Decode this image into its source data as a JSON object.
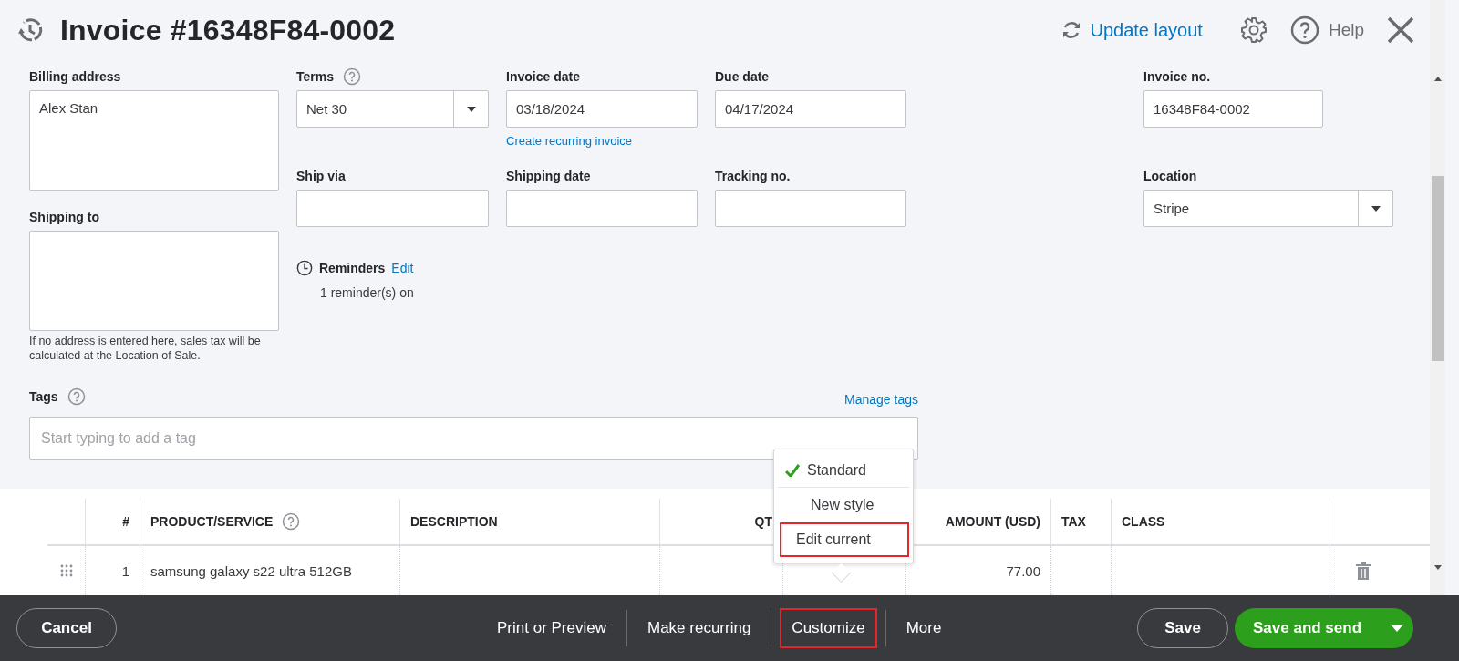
{
  "header": {
    "title": "Invoice #16348F84-0002",
    "update_layout": "Update layout",
    "help": "Help"
  },
  "form": {
    "billing_address": {
      "label": "Billing address",
      "value": "Alex Stan"
    },
    "shipping_to": {
      "label": "Shipping to",
      "note": "If no address is entered here, sales tax will be calculated at the Location of Sale."
    },
    "terms": {
      "label": "Terms",
      "value": "Net 30"
    },
    "invoice_date": {
      "label": "Invoice date",
      "value": "03/18/2024",
      "link": "Create recurring invoice"
    },
    "due_date": {
      "label": "Due date",
      "value": "04/17/2024"
    },
    "invoice_no": {
      "label": "Invoice no.",
      "value": "16348F84-0002"
    },
    "ship_via": {
      "label": "Ship via"
    },
    "shipping_date": {
      "label": "Shipping date"
    },
    "tracking_no": {
      "label": "Tracking no."
    },
    "location": {
      "label": "Location",
      "value": "Stripe"
    },
    "reminders": {
      "label": "Reminders",
      "edit": "Edit",
      "status": "1 reminder(s) on"
    },
    "tags": {
      "label": "Tags",
      "manage": "Manage tags",
      "placeholder": "Start typing to add a tag"
    }
  },
  "table": {
    "columns": [
      "#",
      "PRODUCT/SERVICE",
      "DESCRIPTION",
      "QT",
      "AMOUNT (USD)",
      "TAX",
      "CLASS"
    ],
    "rows": [
      {
        "number": "1",
        "product": "samsung galaxy s22 ultra 512GB",
        "amount": "77.00"
      }
    ]
  },
  "style_menu": [
    {
      "label": "Standard",
      "checked": true,
      "highlighted": false
    },
    {
      "label": "New style",
      "checked": false,
      "highlighted": false
    },
    {
      "label": "Edit current",
      "checked": false,
      "highlighted": true
    }
  ],
  "footer": {
    "cancel": "Cancel",
    "actions": [
      {
        "label": "Print or Preview",
        "highlighted": false
      },
      {
        "label": "Make recurring",
        "highlighted": false
      },
      {
        "label": "Customize",
        "highlighted": true
      },
      {
        "label": "More",
        "highlighted": false
      }
    ],
    "save": "Save",
    "save_and_send": "Save and send"
  }
}
